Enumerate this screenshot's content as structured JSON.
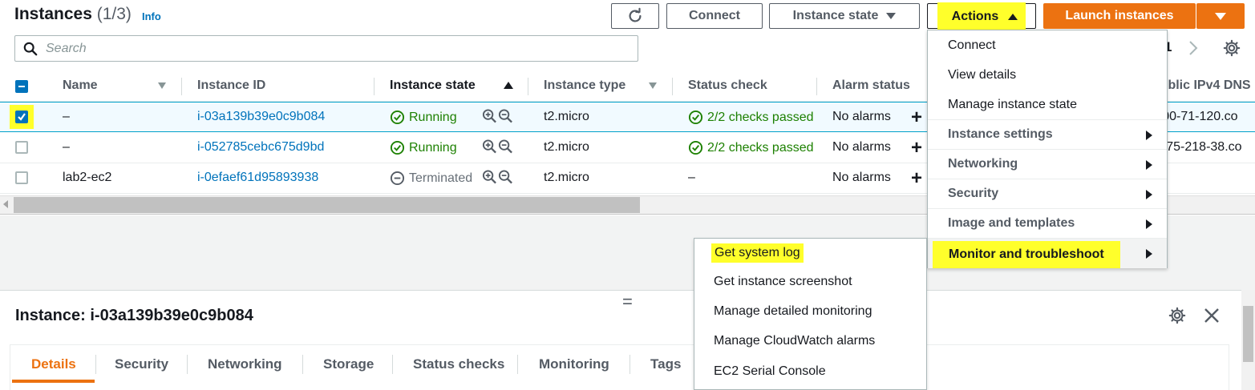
{
  "header": {
    "title": "Instances",
    "count": "(1/3)",
    "info": "Info"
  },
  "toolbar": {
    "connect": "Connect",
    "instance_state": "Instance state",
    "actions": "Actions",
    "launch": "Launch instances"
  },
  "search": {
    "placeholder": "Search"
  },
  "pagination": {
    "page": "1"
  },
  "table": {
    "columns": [
      "Name",
      "Instance ID",
      "Instance state",
      "Instance type",
      "Status check",
      "Alarm status",
      "Public IPv4 DNS"
    ],
    "rows": [
      {
        "name": "–",
        "id": "i-03a139b39e0c9b084",
        "state": "Running",
        "type": "t2.micro",
        "status": "2/2 checks passed",
        "alarm": "No alarms",
        "dns": "ec2-3-200-71-120.co",
        "selected": true
      },
      {
        "name": "–",
        "id": "i-052785cebc675d9bd",
        "state": "Running",
        "type": "t2.micro",
        "status": "2/2 checks passed",
        "alarm": "No alarms",
        "dns": "ec2-3-175-218-38.co",
        "selected": false
      },
      {
        "name": "lab2-ec2",
        "id": "i-0efaef61d95893938",
        "state": "Terminated",
        "type": "t2.micro",
        "status": "–",
        "alarm": "No alarms",
        "dns": "",
        "selected": false
      }
    ]
  },
  "actions_menu": {
    "items": [
      "Connect",
      "View details",
      "Manage instance state"
    ],
    "groups": [
      "Instance settings",
      "Networking",
      "Security",
      "Image and templates",
      "Monitor and troubleshoot"
    ]
  },
  "monitor_submenu": {
    "items": [
      "Get system log",
      "Get instance screenshot",
      "Manage detailed monitoring",
      "Manage CloudWatch alarms",
      "EC2 Serial Console"
    ]
  },
  "details_panel": {
    "title": "Instance: i-03a139b39e0c9b084",
    "tabs": [
      "Details",
      "Security",
      "Networking",
      "Storage",
      "Status checks",
      "Monitoring",
      "Tags"
    ]
  },
  "colors": {
    "accent": "#ec7211",
    "link": "#0073bb",
    "success": "#1d8102",
    "highlight": "#ffff2b"
  }
}
